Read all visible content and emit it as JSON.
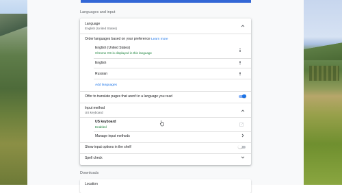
{
  "wallpaper": {
    "left": "mountain-landscape",
    "right": "valley-landscape"
  },
  "sections": {
    "languages_title": "Languages and input",
    "downloads_title": "Downloads"
  },
  "language": {
    "label": "Language",
    "value": "English (United States)",
    "order_text": "Order languages based on your preference",
    "learn_more": "Learn more",
    "items": [
      {
        "name": "English (United States)",
        "note": "Chrome OS is displayed in this language"
      },
      {
        "name": "English",
        "note": ""
      },
      {
        "name": "Russian",
        "note": ""
      }
    ],
    "add_languages": "Add languages",
    "offer_translate": "Offer to translate pages that aren't in a language you read",
    "offer_translate_on": true
  },
  "input_method": {
    "label": "Input method",
    "value": "US keyboard",
    "keyboard_name": "US keyboard",
    "keyboard_status": "Enabled",
    "manage": "Manage input methods",
    "show_in_shelf": "Show input options in the shelf",
    "show_in_shelf_on": false,
    "spell_check": "Spell check"
  },
  "downloads": {
    "location_label": "Location"
  },
  "colors": {
    "accent": "#1a73e8",
    "enabled_green": "#188038",
    "toggle_on": "#1a73e8",
    "top_bar": "#3367d6"
  }
}
